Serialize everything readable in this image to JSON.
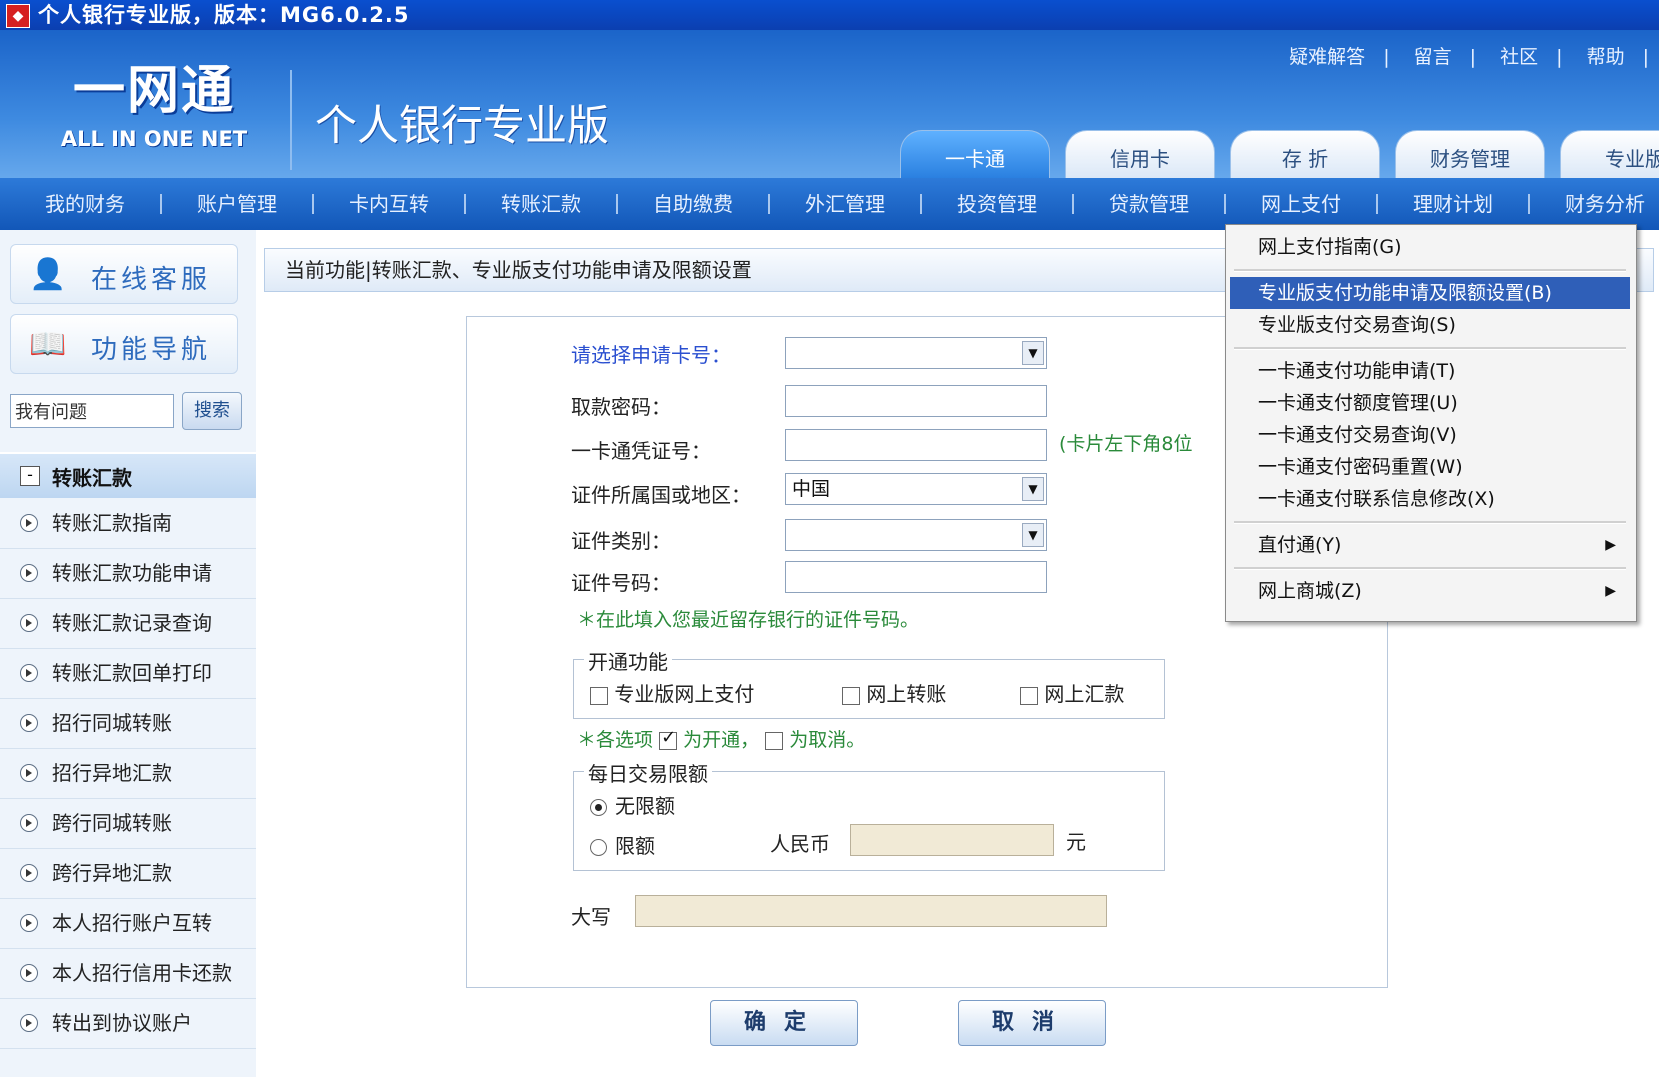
{
  "window": {
    "title": "个人银行专业版，版本：MG6.0.2.5"
  },
  "header": {
    "logo_cn": "一网通",
    "logo_en": "ALL IN ONE NET",
    "product_name": "个人银行专业版",
    "links": [
      "疑难解答",
      "留言",
      "社区",
      "帮助"
    ]
  },
  "top_tabs": [
    "一卡通",
    "信用卡",
    "存 折",
    "财务管理",
    "专业版"
  ],
  "nav": [
    "我的财务",
    "账户管理",
    "卡内互转",
    "转账汇款",
    "自助缴费",
    "外汇管理",
    "投资管理",
    "贷款管理",
    "网上支付",
    "理财计划",
    "财务分析"
  ],
  "sidebar": {
    "online_service": "在线客服",
    "function_nav": "功能导航",
    "search_value": "我有问题",
    "search_button": "搜索",
    "section": "转账汇款",
    "items": [
      "转账汇款指南",
      "转账汇款功能申请",
      "转账汇款记录查询",
      "转账汇款回单打印",
      "招行同城转账",
      "招行异地汇款",
      "跨行同城转账",
      "跨行异地汇款",
      "本人招行账户互转",
      "本人招行信用卡还款",
      "转出到协议账户"
    ]
  },
  "main": {
    "breadcrumb": "当前功能|转账汇款、专业版支付功能申请及限额设置",
    "form": {
      "card_label": "请选择申请卡号：",
      "password_label": "取款密码：",
      "voucher_label": "一卡通凭证号：",
      "voucher_hint": "(卡片左下角8位",
      "region_label": "证件所属国或地区：",
      "region_value": "中国",
      "id_type_label": "证件类别：",
      "id_number_label": "证件号码：",
      "id_note": "＊在此填入您最近留存银行的证件号码。",
      "open_legend": "开通功能",
      "open_options": [
        "专业版网上支付",
        "网上转账",
        "网上汇款"
      ],
      "check_note_prefix": "＊各选项",
      "check_note_mid": "为开通，",
      "check_note_suffix": "为取消。",
      "limit_legend": "每日交易限额",
      "limit_none": "无限额",
      "limit_set": "限额",
      "currency_label": "人民币",
      "unit_label": "元",
      "uppercase_label": "大写"
    },
    "buttons": {
      "ok": "确定",
      "cancel": "取消"
    }
  },
  "dropdown": {
    "items": [
      "网上支付指南(G)",
      "专业版支付功能申请及限额设置(B)",
      "专业版支付交易查询(S)",
      "一卡通支付功能申请(T)",
      "一卡通支付额度管理(U)",
      "一卡通支付交易查询(V)",
      "一卡通支付密码重置(W)",
      "一卡通支付联系信息修改(X)",
      "直付通(Y)",
      "网上商城(Z)"
    ]
  },
  "colors": {
    "title_bar": "#0b3fb0",
    "nav_bar": "#1257b8",
    "menu_highlight": "#2f5fb8",
    "note_green": "#2a8a3a"
  }
}
